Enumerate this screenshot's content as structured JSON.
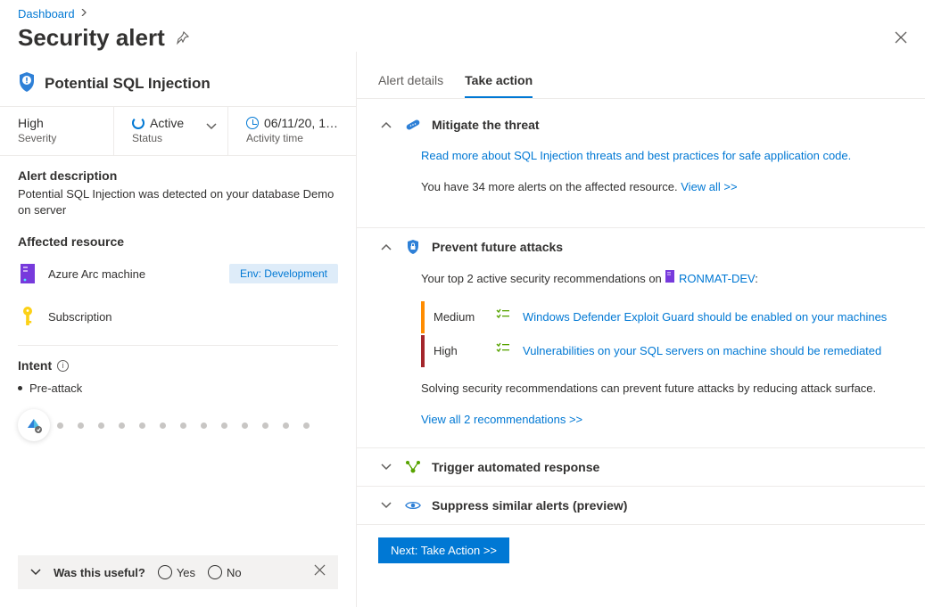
{
  "breadcrumb": {
    "root": "Dashboard"
  },
  "page_title": "Security alert",
  "alert": {
    "title": "Potential SQL Injection",
    "severity_value": "High",
    "severity_label": "Severity",
    "status_value": "Active",
    "status_label": "Status",
    "time_value": "06/11/20, 1…",
    "time_label": "Activity time"
  },
  "description": {
    "heading": "Alert description",
    "text": "Potential SQL Injection was detected on your database Demo on server"
  },
  "affected": {
    "heading": "Affected resource",
    "row1": "Azure Arc machine",
    "row1_pill": "Env: Development",
    "row2": "Subscription"
  },
  "intent": {
    "heading": "Intent",
    "item1": "Pre-attack"
  },
  "feedback": {
    "question": "Was this useful?",
    "yes": "Yes",
    "no": "No"
  },
  "tabs": {
    "details": "Alert details",
    "action": "Take action"
  },
  "mitigate": {
    "title": "Mitigate the threat",
    "link": "Read more about SQL Injection threats and best practices for safe application code.",
    "para_a": "You have 34 more alerts on the affected resource. ",
    "view_all": "View all >>"
  },
  "prevent": {
    "title": "Prevent future attacks",
    "intro_a": "Your top 2 active security recommendations on ",
    "resource": "RONMAT-DEV",
    "colon": ":",
    "rec1_sev": "Medium",
    "rec1": "Windows Defender Exploit Guard should be enabled on your machines",
    "rec2_sev": "High",
    "rec2": "Vulnerabilities on your SQL servers on machine should be remediated",
    "outro": "Solving security recommendations can prevent future attacks by reducing attack surface.",
    "view_all": "View all 2 recommendations >>"
  },
  "trigger": {
    "title": "Trigger automated response"
  },
  "suppress": {
    "title": "Suppress similar alerts (preview)"
  },
  "next_btn": "Next: Take Action >>"
}
